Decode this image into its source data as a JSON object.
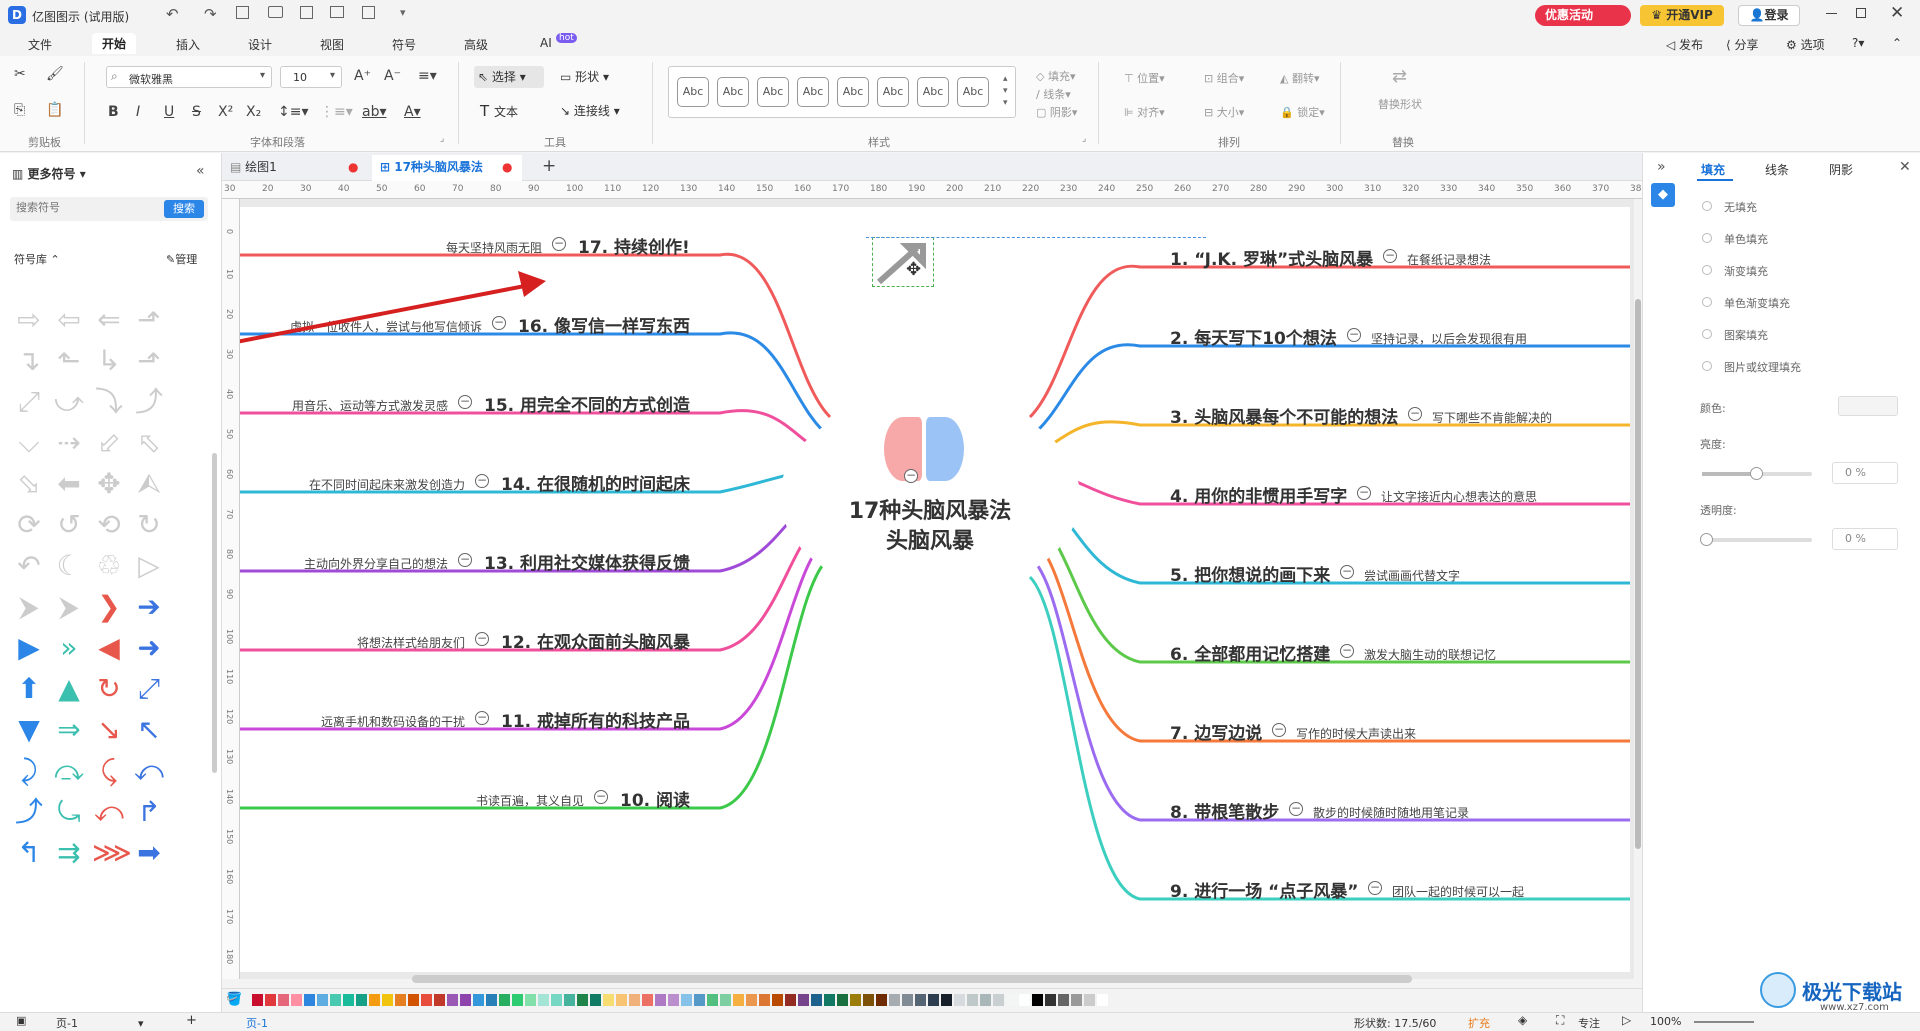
{
  "app": {
    "title": "亿图图示 (试用版)",
    "promo_label": "优惠活动",
    "vip_label": "开通VIP",
    "login_label": "登录"
  },
  "menu": {
    "items": [
      "文件",
      "开始",
      "插入",
      "设计",
      "视图",
      "符号",
      "高级",
      "AI"
    ],
    "ai_badge": "hot",
    "right": [
      "发布",
      "分享",
      "选项"
    ]
  },
  "ribbon": {
    "font_name": "微软雅黑",
    "font_size": "10",
    "select_label": "选择",
    "shape_label": "形状",
    "text_label": "文本",
    "connector_label": "连接线",
    "style_preview": "Abc",
    "fill_label": "填充",
    "line_label": "线条",
    "shadow_label": "阴影",
    "position_label": "位置",
    "group_label": "组合",
    "flip_label": "翻转",
    "align_label": "对齐",
    "size_label": "大小",
    "lock_label": "锁定",
    "replace_shape_label": "替换形状",
    "groups": {
      "clipboard": "剪贴板",
      "font_para": "字体和段落",
      "tools": "工具",
      "styles": "样式",
      "arrange": "排列",
      "replace": "替换"
    }
  },
  "left_panel": {
    "title": "更多符号",
    "search_placeholder": "搜索符号",
    "search_btn": "搜索",
    "library_label": "符号库",
    "manage_label": "管理"
  },
  "tabs": [
    {
      "label": "绘图1"
    },
    {
      "label": "17种头脑风暴法"
    }
  ],
  "ruler": {
    "h": [
      "30",
      "20",
      "30",
      "40",
      "50",
      "60",
      "70",
      "80",
      "90",
      "100",
      "110",
      "120",
      "130",
      "140",
      "150",
      "160",
      "170",
      "180",
      "190",
      "200",
      "210",
      "220",
      "230",
      "240",
      "250",
      "260",
      "270",
      "280",
      "290",
      "300",
      "310",
      "320",
      "330",
      "340",
      "350",
      "360",
      "370",
      "380"
    ],
    "v": [
      "0",
      "10",
      "20",
      "30",
      "40",
      "50",
      "60",
      "70",
      "80",
      "90",
      "100",
      "110",
      "120",
      "130",
      "140",
      "150",
      "160",
      "170",
      "180"
    ]
  },
  "mindmap": {
    "center_line1": "17种头脑风暴法",
    "center_line2": "头脑风暴",
    "right": [
      {
        "title": "1. “J.K. 罗琳”式头脑风暴",
        "note": "在餐纸记录想法",
        "color": "#f05a5a"
      },
      {
        "title": "2. 每天写下10个想法",
        "note": "坚持记录，以后会发现很有用",
        "color": "#2b8ae6"
      },
      {
        "title": "3. 头脑风暴每个不可能的想法",
        "note": "写下哪些不肯能解决的",
        "color": "#f5b52a"
      },
      {
        "title": "4. 用你的非惯用手写字",
        "note": "让文字接近内心想表达的意思",
        "color": "#f04f9c"
      },
      {
        "title": "5. 把你想说的画下来",
        "note": "尝试画画代替文字",
        "color": "#2fb8d6"
      },
      {
        "title": "6. 全部都用记忆搭建",
        "note": "激发大脑生动的联想记忆",
        "color": "#5cc94a"
      },
      {
        "title": "7. 边写边说",
        "note": "写作的时候大声读出来",
        "color": "#f5793a"
      },
      {
        "title": "8. 带根笔散步",
        "note": "散步的时候随时随地用笔记录",
        "color": "#9b6cf0"
      },
      {
        "title": "9. 进行一场 “点子风暴”",
        "note": "团队一起的时候可以一起",
        "color": "#3ccfc0"
      }
    ],
    "left": [
      {
        "title": "17. 持续创作!",
        "note": "每天坚持风雨无阻",
        "color": "#f05a5a"
      },
      {
        "title": "16. 像写信一样写东西",
        "note": "虚拟一位收件人，尝试与他写信倾诉",
        "color": "#2b8ae6"
      },
      {
        "title": "15. 用完全不同的方式创造",
        "note": "用音乐、运动等方式激发灵感",
        "color": "#f04f9c"
      },
      {
        "title": "14. 在很随机的时间起床",
        "note": "在不同时间起床来激发创造力",
        "color": "#2fb8d6"
      },
      {
        "title": "13. 利用社交媒体获得反馈",
        "note": "主动向外界分享自己的想法",
        "color": "#a04ad8"
      },
      {
        "title": "12. 在观众面前头脑风暴",
        "note": "将想法样式给朋友们",
        "color": "#f04f9c"
      },
      {
        "title": "11. 戒掉所有的科技产品",
        "note": "远离手机和数码设备的干扰",
        "color": "#c94ad8"
      },
      {
        "title": "10. 阅读",
        "note": "书读百遍，其义自见",
        "color": "#3cc94a"
      }
    ]
  },
  "right_panel": {
    "tabs": [
      "填充",
      "线条",
      "阴影"
    ],
    "options": [
      "无填充",
      "单色填充",
      "渐变填充",
      "单色渐变填充",
      "图案填充",
      "图片或纹理填充"
    ],
    "color_label": "颜色:",
    "brightness_label": "亮度:",
    "transparency_label": "透明度:",
    "pct1": "0 %",
    "pct2": "0 %"
  },
  "status": {
    "page_label": "页-1",
    "page_tab": "页-1",
    "shape_count": "形状数: 17.5/60",
    "expand": "扩充",
    "focus": "专注",
    "zoom": "100%"
  },
  "watermark": {
    "text": "极光下载站",
    "url": "www.xz7.com"
  },
  "palette": [
    "#c8102e",
    "#e03a3e",
    "#e7677a",
    "#ff8fa3",
    "#2e86de",
    "#5dade2",
    "#48c9b0",
    "#1abc9c",
    "#16a085",
    "#f39c12",
    "#f1c40f",
    "#e67e22",
    "#d35400",
    "#e74c3c",
    "#c0392b",
    "#9b59b6",
    "#8e44ad",
    "#3498db",
    "#2980b9",
    "#27ae60",
    "#2ecc71",
    "#82e0aa",
    "#a3e4d7",
    "#76d7c4",
    "#45b39d",
    "#1e8449",
    "#117a65",
    "#f7dc6f",
    "#f8c471",
    "#f0b27a",
    "#ec7063",
    "#af7ac5",
    "#bb8fce",
    "#85c1e9",
    "#5499c7",
    "#52be80",
    "#7dcea0",
    "#f5b041",
    "#eb984e",
    "#dc7633",
    "#ba4a00",
    "#922b21",
    "#76448a",
    "#1f618d",
    "#117864",
    "#196f3d",
    "#9a7d0a",
    "#7e5109",
    "#6e2c00",
    "#a6acaf",
    "#808b96",
    "#566573",
    "#2c3e50",
    "#17202a",
    "#d7dbdd",
    "#bfc9ca",
    "#aab7b8",
    "#cacfd2",
    "#f4f6f6",
    "#fdfefe",
    "#000000",
    "#333333",
    "#666666",
    "#999999",
    "#cccccc",
    "#ffffff"
  ]
}
